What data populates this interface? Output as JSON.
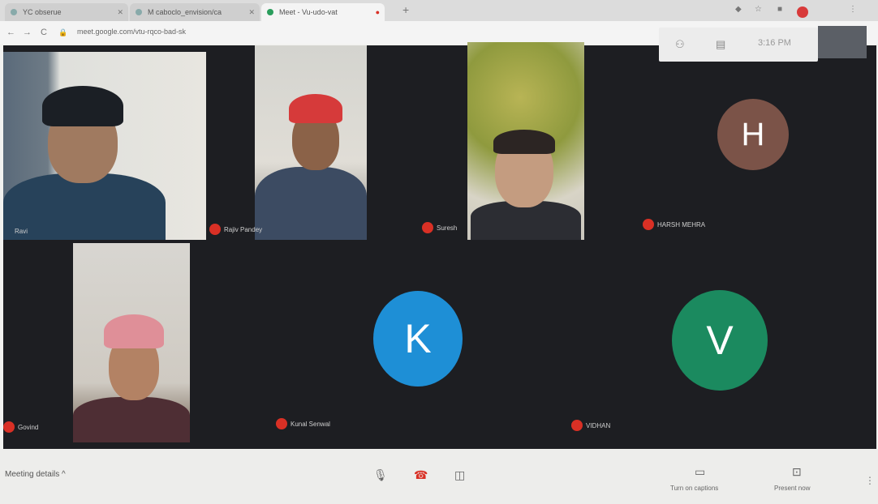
{
  "browser": {
    "tabs": [
      {
        "title": "YC obserue"
      },
      {
        "title": "M caboclo_envision/ca"
      },
      {
        "title": "Meet - Vu-udo-vat"
      }
    ],
    "new_tab_glyph": "+",
    "url": "meet.google.com/vtu-rqco-bad-sk",
    "nav_glyphs": {
      "back": "←",
      "forward": "→",
      "reload": "C"
    }
  },
  "overlay": {
    "time": "3:16 PM"
  },
  "participants": [
    {
      "name": "Ravi",
      "type": "video"
    },
    {
      "name": "Rajiv Pandey",
      "type": "video"
    },
    {
      "name": "Suresh",
      "type": "video"
    },
    {
      "name": "HARSH MEHRA",
      "type": "avatar",
      "initial": "H",
      "color": "#7b5348"
    },
    {
      "name": "Govind",
      "type": "video"
    },
    {
      "name": "Kunal Senwal",
      "type": "avatar",
      "initial": "K",
      "color": "#1e8fd6"
    },
    {
      "name": "VIDHAN",
      "type": "avatar",
      "initial": "V",
      "color": "#1b8a5f"
    }
  ],
  "bottom_bar": {
    "meeting_details": "Meeting details",
    "chevron": "^",
    "turn_on_captions": "Turn on captions",
    "present_now": "Present now"
  },
  "colors": {
    "stage": "#1d1e22",
    "mic_muted": "#d93025",
    "hangup": "#d93025"
  }
}
